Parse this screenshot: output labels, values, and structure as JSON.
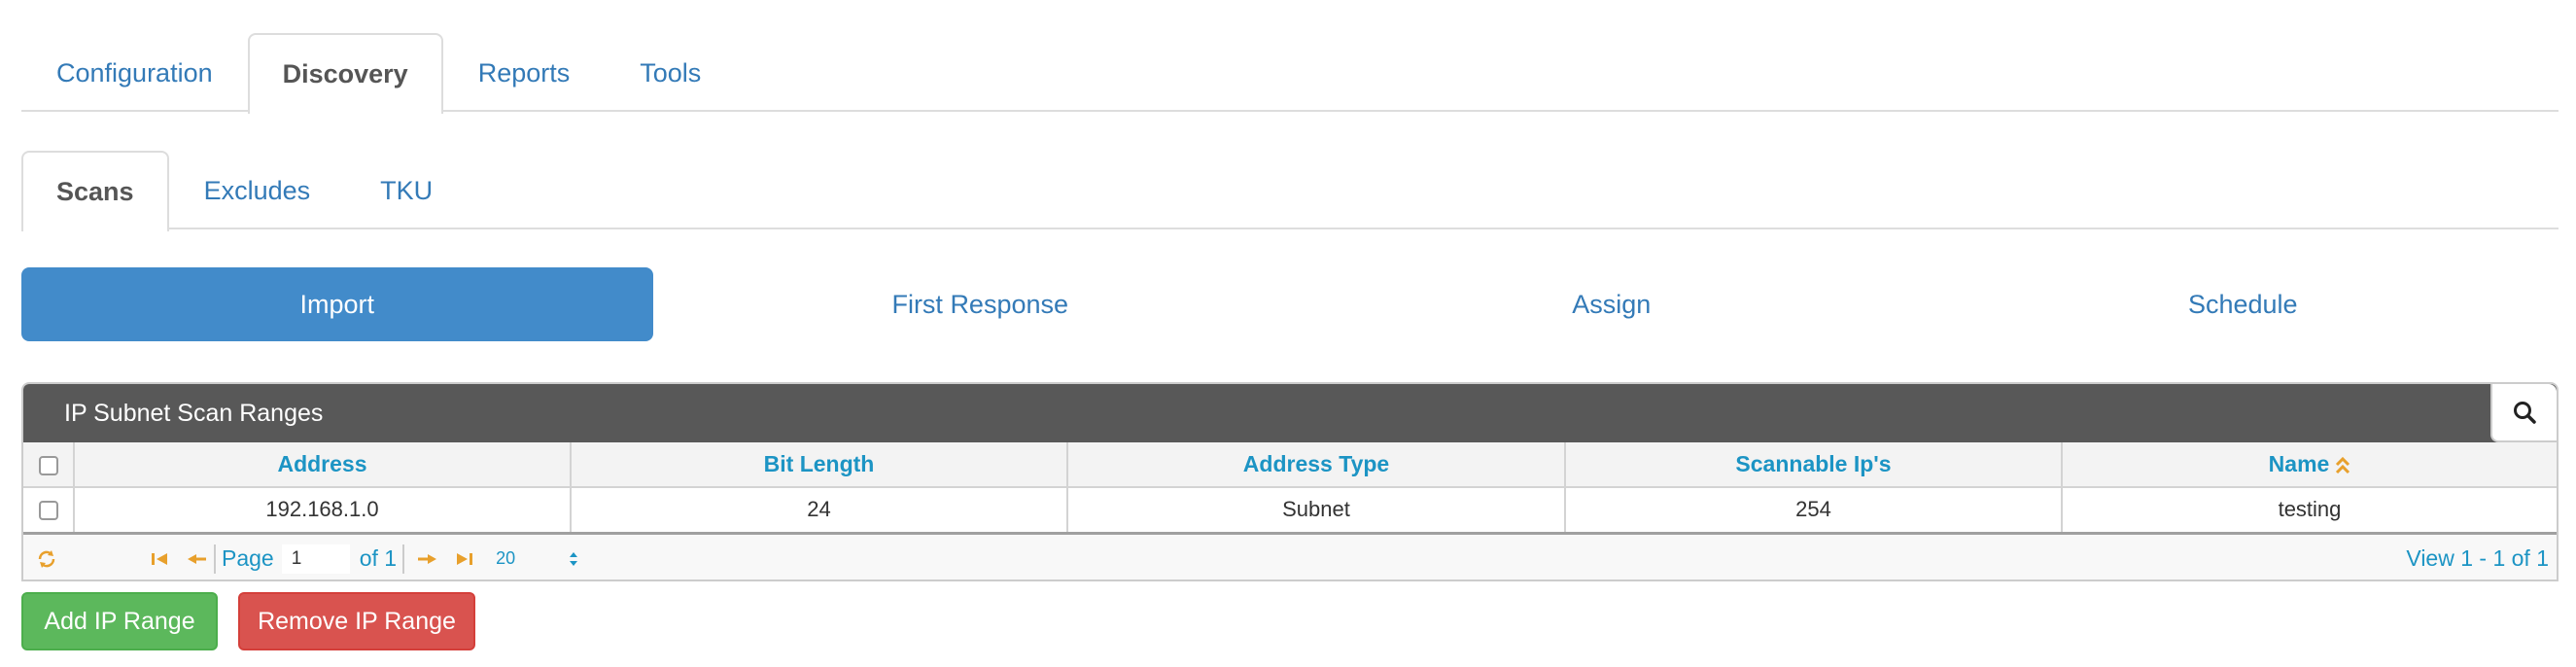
{
  "main_tabs": [
    {
      "label": "Configuration"
    },
    {
      "label": "Discovery"
    },
    {
      "label": "Reports"
    },
    {
      "label": "Tools"
    }
  ],
  "sub_tabs": [
    {
      "label": "Scans"
    },
    {
      "label": "Excludes"
    },
    {
      "label": "TKU"
    }
  ],
  "pills": [
    {
      "label": "Import"
    },
    {
      "label": "First Response"
    },
    {
      "label": "Assign"
    },
    {
      "label": "Schedule"
    }
  ],
  "grid": {
    "caption": "IP Subnet Scan Ranges",
    "columns": [
      "Address",
      "Bit Length",
      "Address Type",
      "Scannable Ip's",
      "Name"
    ],
    "rows": [
      [
        "192.168.1.0",
        "24",
        "Subnet",
        "254",
        "testing"
      ]
    ],
    "pager": {
      "page_label": "Page",
      "page_value": "1",
      "of_label": "of 1",
      "rows_per_page": "20",
      "view_text": "View 1 - 1 of 1"
    }
  },
  "buttons": {
    "add": "Add IP Range",
    "remove": "Remove IP Range"
  },
  "colors": {
    "link": "#337ab7",
    "pill_active": "#428bca",
    "caption_bg": "#585858",
    "header_text": "#1c94c4",
    "pager_icon": "#e8a02c",
    "add_button": "#5cb85c",
    "remove_button": "#d9534f"
  }
}
